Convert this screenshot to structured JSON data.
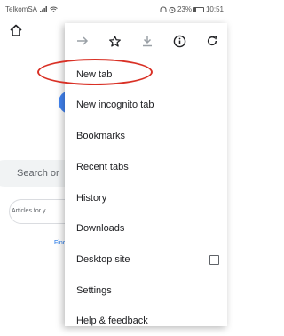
{
  "status_bar": {
    "carrier": "TelkomSA",
    "battery": "23%",
    "battery_level": 0.23,
    "time": "10:51"
  },
  "background_page": {
    "search_text": "Search or",
    "articles_text": "Articles for y",
    "find_text": "Find"
  },
  "menu": {
    "toolbar": {
      "forward_icon": "arrow-right-icon",
      "bookmark_icon": "star-icon",
      "download_icon": "download-icon",
      "info_icon": "info-icon",
      "refresh_icon": "refresh-icon"
    },
    "items": [
      {
        "label": "New tab"
      },
      {
        "label": "New incognito tab"
      },
      {
        "label": "Bookmarks"
      },
      {
        "label": "Recent tabs"
      },
      {
        "label": "History"
      },
      {
        "label": "Downloads"
      },
      {
        "label": "Desktop site",
        "checkbox": false
      },
      {
        "label": "Settings"
      },
      {
        "label": "Help & feedback"
      }
    ]
  },
  "annotation_color": "#d93025"
}
